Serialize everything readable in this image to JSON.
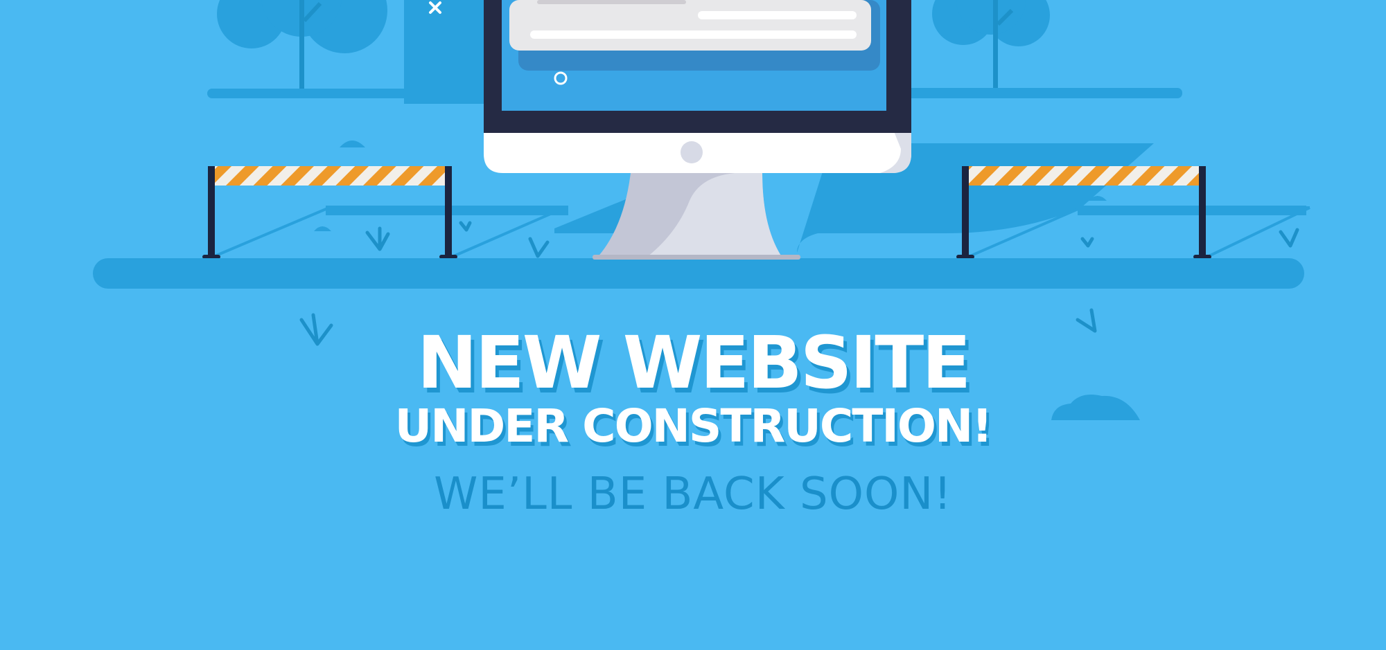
{
  "headline": {
    "line1": "NEW WEBSITE",
    "line2": "UNDER CONSTRUCTION!"
  },
  "tagline": "WE’LL BE BACK SOON!",
  "colors": {
    "background": "#4ab9f2",
    "shape": "#29a1dd",
    "monitor_bezel": "#252a44",
    "screen": "#3aa6e6",
    "barrier_stripe_orange": "#ee9a2a",
    "barrier_stripe_white": "#f2efe9",
    "text_primary": "#ffffff",
    "text_secondary": "#1a8fca"
  },
  "icons": [
    "tree-icon",
    "barrier-icon",
    "monitor-icon",
    "close-icon",
    "circle-icon",
    "cloud-icon",
    "grass-icon"
  ]
}
